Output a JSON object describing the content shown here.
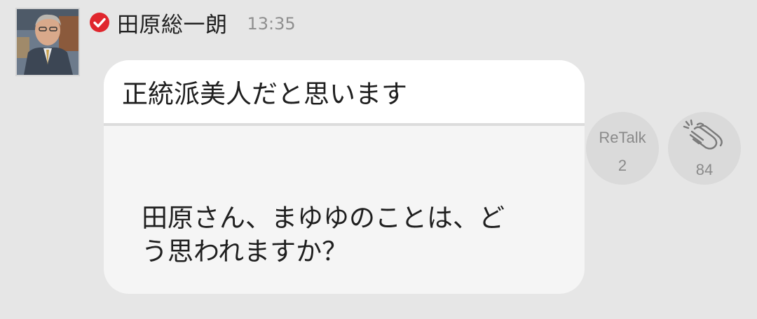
{
  "post": {
    "username": "田原総一朗",
    "time": "13:35",
    "message": "正統派美人だと思います",
    "quoted_question": "田原さん、まゆゆのことは、ど\nう思われますか？"
  },
  "actions": {
    "retalk_label": "ReTalk",
    "retalk_count": "2",
    "clap_count": "84"
  },
  "icons": {
    "verified": "verified-check-icon",
    "clap": "clapping-hands-icon"
  },
  "colors": {
    "background": "#e6e6e6",
    "verified_red": "#e0262d",
    "bubble_main": "#ffffff",
    "bubble_quote": "#f5f5f5",
    "action_circle": "#dadada"
  }
}
